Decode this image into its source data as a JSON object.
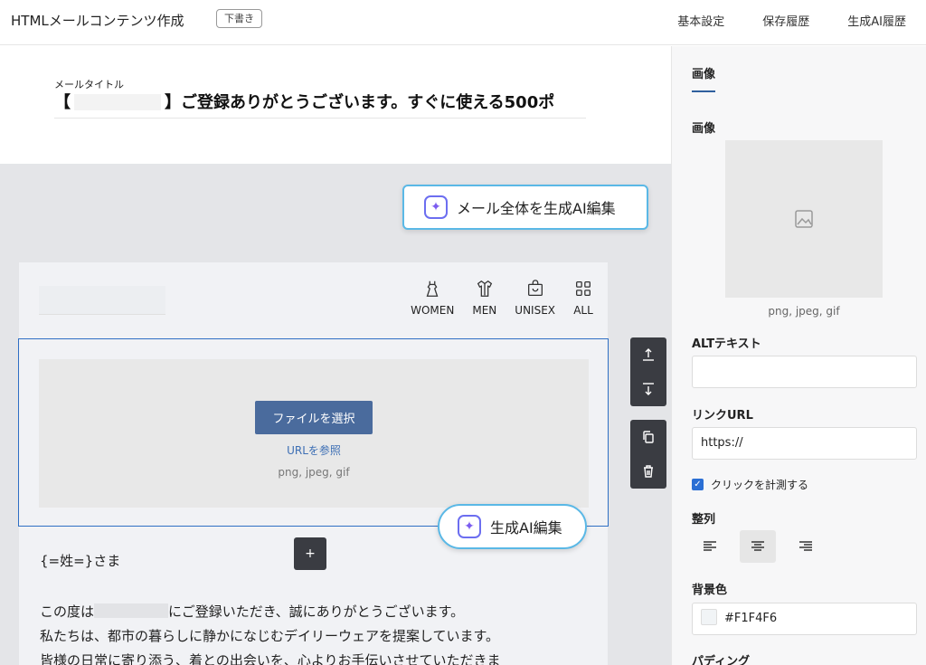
{
  "header": {
    "title": "HTMLメールコンテンツ作成",
    "status_badge": "下書き",
    "nav": [
      "基本設定",
      "保存履歴",
      "生成AI履歴"
    ]
  },
  "mail_title": {
    "label": "メールタイトル",
    "prefix": "【",
    "value": "】ご登録ありがとうございます。すぐに使える500ポ"
  },
  "ai_edit_all": {
    "label": "メール全体を生成AI編集",
    "icon": "sparkle-icon"
  },
  "email": {
    "categories": [
      {
        "label": "WOMEN",
        "icon": "dress-icon"
      },
      {
        "label": "MEN",
        "icon": "shirt-icon"
      },
      {
        "label": "UNISEX",
        "icon": "bag-icon"
      },
      {
        "label": "ALL",
        "icon": "grid-icon"
      }
    ],
    "image_block": {
      "file_button": "ファイルを選択",
      "url_link": "URLを参照",
      "formats": "png, jpeg, gif"
    },
    "ai_edit_block": "生成AI編集",
    "add_block": "+",
    "greeting": "{=姓=}さま",
    "body_line1_a": "この度は",
    "body_line1_b": "にご登録いただき、誠にありがとうございます。",
    "body_line2": "私たちは、都市の暮らしに静かになじむデイリーウェアを提案しています。",
    "body_line3": "皆様の日常に寄り添う、着との出会いを、心よりお手伝いさせていただきま"
  },
  "panel": {
    "tab": "画像",
    "image_label": "画像",
    "image_formats": "png, jpeg, gif",
    "alt_label": "ALTテキスト",
    "alt_value": "",
    "link_label": "リンクURL",
    "link_value": "https://",
    "track_click_label": "クリックを計測する",
    "track_click_checked": true,
    "align_label": "整列",
    "align_selected": "center",
    "bg_label": "背景色",
    "bg_value": "#F1F4F6",
    "padding_label": "パディング"
  }
}
